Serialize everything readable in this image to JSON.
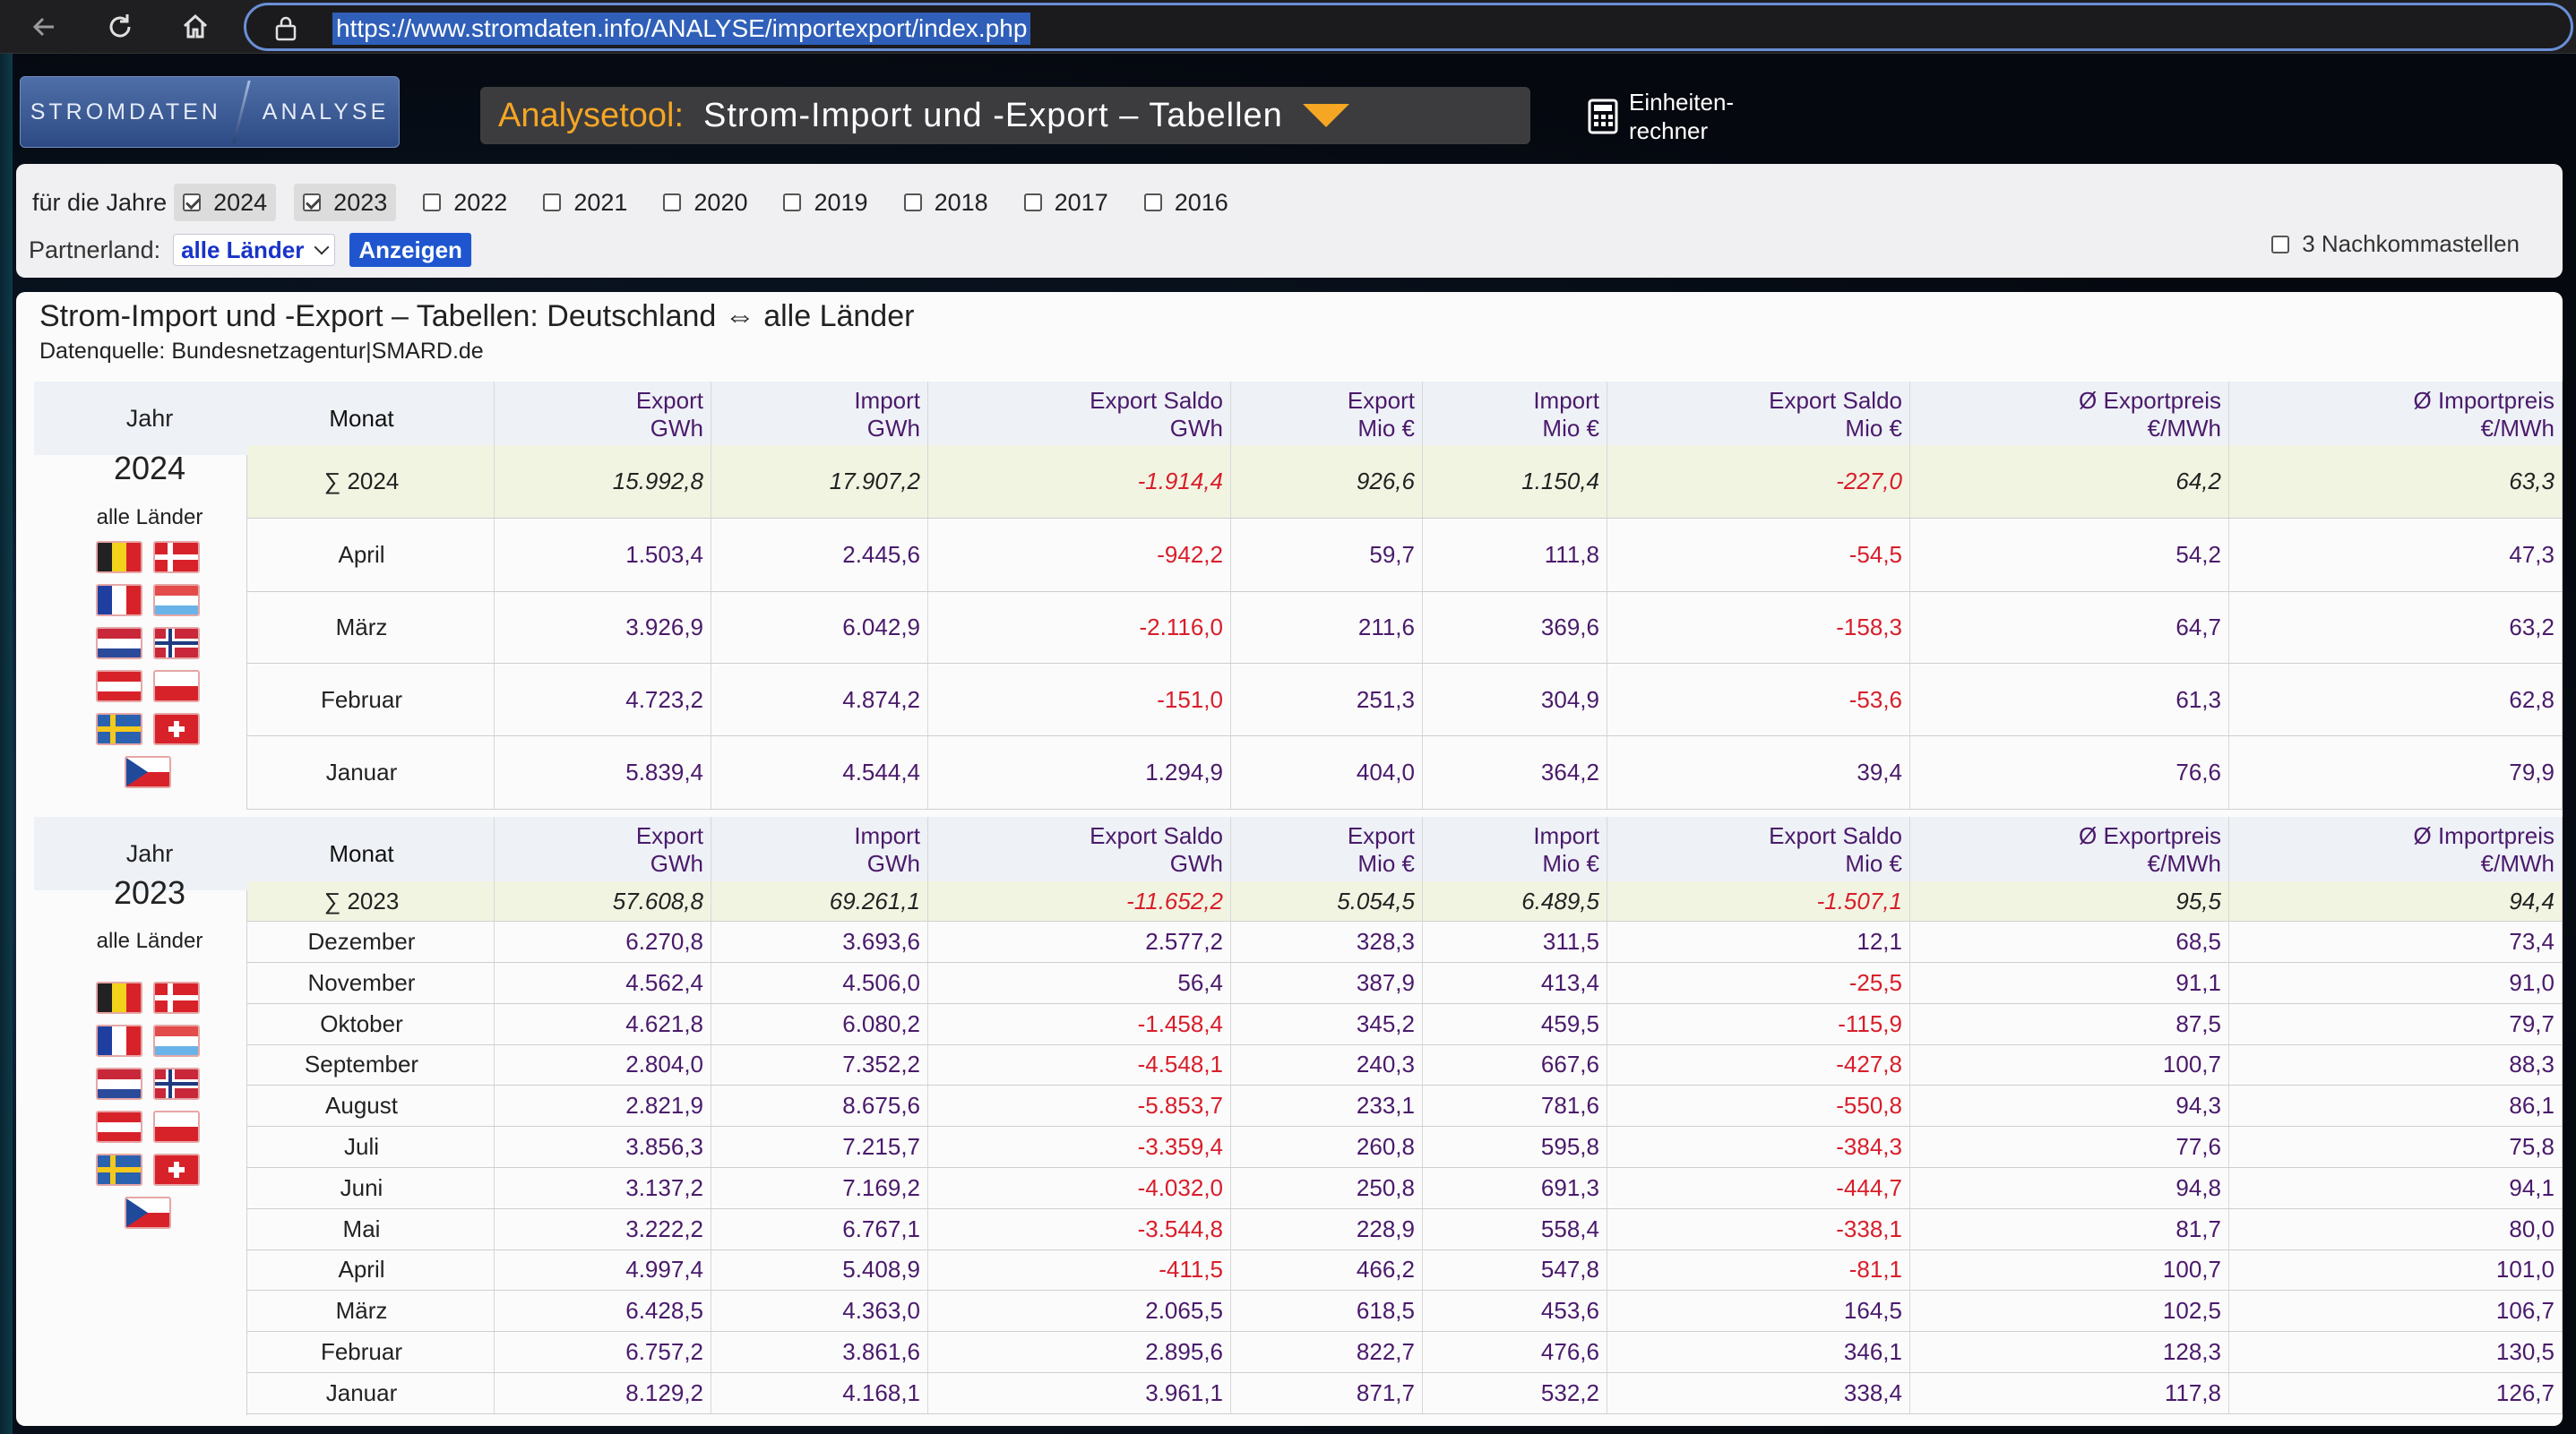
{
  "browser": {
    "url": "https://www.stromdaten.info/ANALYSE/importexport/index.php"
  },
  "header": {
    "logo_left": "STROMDATEN",
    "logo_right": "ANALYSE",
    "title_prefix": "Analysetool:",
    "title_main": "Strom-Import und -Export – Tabellen",
    "calculator_label_1": "Einheiten-",
    "calculator_label_2": "rechner"
  },
  "filter": {
    "years_label": "für die Jahre",
    "years": [
      {
        "label": "2024",
        "checked": true
      },
      {
        "label": "2023",
        "checked": true
      },
      {
        "label": "2022",
        "checked": false
      },
      {
        "label": "2021",
        "checked": false
      },
      {
        "label": "2020",
        "checked": false
      },
      {
        "label": "2019",
        "checked": false
      },
      {
        "label": "2018",
        "checked": false
      },
      {
        "label": "2017",
        "checked": false
      },
      {
        "label": "2016",
        "checked": false
      }
    ],
    "partner_label": "Partnerland:",
    "partner_value": "alle Länder",
    "show_button": "Anzeigen",
    "decimals_label": "3 Nachkommastellen"
  },
  "panel": {
    "title": "Strom-Import und -Export – Tabellen: Deutschland ⇔ alle Länder",
    "source": "Datenquelle: Bundesnetzagentur|SMARD.de"
  },
  "columns": {
    "year": "Jahr",
    "month": "Monat",
    "headers": [
      [
        "Export",
        "GWh"
      ],
      [
        "Import",
        "GWh"
      ],
      [
        "Export Saldo",
        "GWh"
      ],
      [
        "Export",
        "Mio €"
      ],
      [
        "Import",
        "Mio €"
      ],
      [
        "Export Saldo",
        "Mio €"
      ],
      [
        "Ø Exportpreis",
        "€/MWh"
      ],
      [
        "Ø Importpreis",
        "€/MWh"
      ]
    ]
  },
  "tables": [
    {
      "year": "2024",
      "partner": "alle Länder",
      "sum_label": "∑ 2024",
      "sum": [
        "15.992,8",
        "17.907,2",
        "-1.914,4",
        "926,6",
        "1.150,4",
        "-227,0",
        "64,2",
        "63,3"
      ],
      "rows": [
        {
          "month": "April",
          "values": [
            "1.503,4",
            "2.445,6",
            "-942,2",
            "59,7",
            "111,8",
            "-54,5",
            "54,2",
            "47,3"
          ]
        },
        {
          "month": "März",
          "values": [
            "3.926,9",
            "6.042,9",
            "-2.116,0",
            "211,6",
            "369,6",
            "-158,3",
            "64,7",
            "63,2"
          ]
        },
        {
          "month": "Februar",
          "values": [
            "4.723,2",
            "4.874,2",
            "-151,0",
            "251,3",
            "304,9",
            "-53,6",
            "61,3",
            "62,8"
          ]
        },
        {
          "month": "Januar",
          "values": [
            "5.839,4",
            "4.544,4",
            "1.294,9",
            "404,0",
            "364,2",
            "39,4",
            "76,6",
            "79,9"
          ]
        }
      ]
    },
    {
      "year": "2023",
      "partner": "alle Länder",
      "sum_label": "∑ 2023",
      "sum": [
        "57.608,8",
        "69.261,1",
        "-11.652,2",
        "5.054,5",
        "6.489,5",
        "-1.507,1",
        "95,5",
        "94,4"
      ],
      "rows": [
        {
          "month": "Dezember",
          "values": [
            "6.270,8",
            "3.693,6",
            "2.577,2",
            "328,3",
            "311,5",
            "12,1",
            "68,5",
            "73,4"
          ]
        },
        {
          "month": "November",
          "values": [
            "4.562,4",
            "4.506,0",
            "56,4",
            "387,9",
            "413,4",
            "-25,5",
            "91,1",
            "91,0"
          ]
        },
        {
          "month": "Oktober",
          "values": [
            "4.621,8",
            "6.080,2",
            "-1.458,4",
            "345,2",
            "459,5",
            "-115,9",
            "87,5",
            "79,7"
          ]
        },
        {
          "month": "September",
          "values": [
            "2.804,0",
            "7.352,2",
            "-4.548,1",
            "240,3",
            "667,6",
            "-427,8",
            "100,7",
            "88,3"
          ]
        },
        {
          "month": "August",
          "values": [
            "2.821,9",
            "8.675,6",
            "-5.853,7",
            "233,1",
            "781,6",
            "-550,8",
            "94,3",
            "86,1"
          ]
        },
        {
          "month": "Juli",
          "values": [
            "3.856,3",
            "7.215,7",
            "-3.359,4",
            "260,8",
            "595,8",
            "-384,3",
            "77,6",
            "75,8"
          ]
        },
        {
          "month": "Juni",
          "values": [
            "3.137,2",
            "7.169,2",
            "-4.032,0",
            "250,8",
            "691,3",
            "-444,7",
            "94,8",
            "94,1"
          ]
        },
        {
          "month": "Mai",
          "values": [
            "3.222,2",
            "6.767,1",
            "-3.544,8",
            "228,9",
            "558,4",
            "-338,1",
            "81,7",
            "80,0"
          ]
        },
        {
          "month": "April",
          "values": [
            "4.997,4",
            "5.408,9",
            "-411,5",
            "466,2",
            "547,8",
            "-81,1",
            "100,7",
            "101,0"
          ]
        },
        {
          "month": "März",
          "values": [
            "6.428,5",
            "4.363,0",
            "2.065,5",
            "618,5",
            "453,6",
            "164,5",
            "102,5",
            "106,7"
          ]
        },
        {
          "month": "Februar",
          "values": [
            "6.757,2",
            "3.861,6",
            "2.895,6",
            "822,7",
            "476,6",
            "346,1",
            "128,3",
            "130,5"
          ]
        },
        {
          "month": "Januar",
          "values": [
            "8.129,2",
            "4.168,1",
            "3.961,1",
            "871,7",
            "532,2",
            "338,4",
            "117,8",
            "126,7"
          ]
        }
      ]
    }
  ],
  "flags": [
    "flag-belgium-icon",
    "flag-denmark-icon",
    "flag-france-icon",
    "flag-luxembourg-icon",
    "flag-netherlands-icon",
    "flag-norway-icon",
    "flag-austria-icon",
    "flag-poland-icon",
    "flag-sweden-icon",
    "flag-switzerland-icon",
    "flag-czechia-icon"
  ]
}
